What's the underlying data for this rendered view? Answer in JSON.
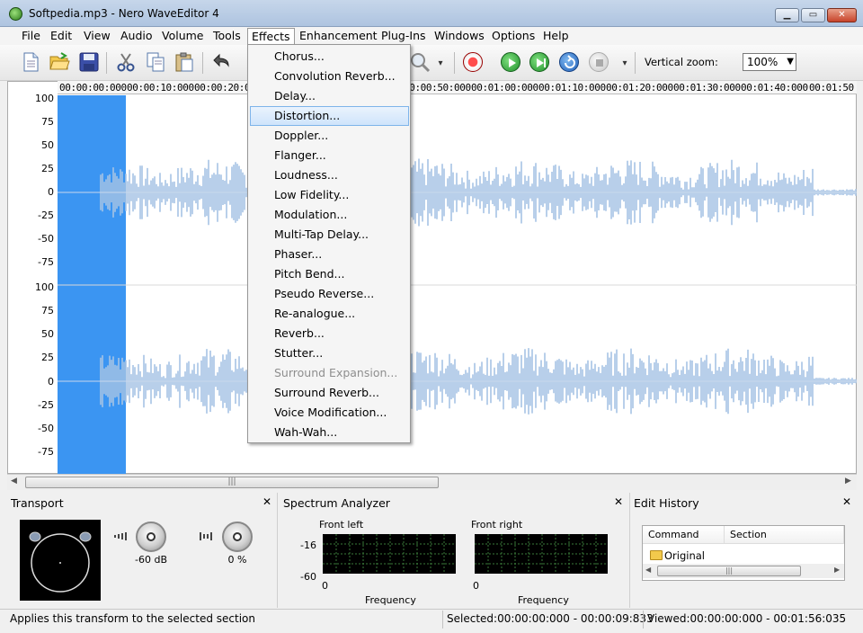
{
  "window": {
    "title": "Softpedia.mp3 - Nero WaveEditor 4"
  },
  "menu": [
    "File",
    "Edit",
    "View",
    "Audio",
    "Volume",
    "Tools",
    "Effects",
    "Enhancement",
    "Plug-Ins",
    "Windows",
    "Options",
    "Help"
  ],
  "toolbar": {
    "zoom_label": "Vertical zoom:",
    "zoom_value": "100%"
  },
  "ruler": [
    "00:00:00:000",
    "00:00:10:000",
    "00:00:20:000",
    "00:00:50:000",
    "00:01:00:000",
    "00:01:10:000",
    "00:01:20:000",
    "00:01:30:000",
    "00:01:40:000",
    "00:01:50"
  ],
  "y_axis_top": [
    "100",
    "75",
    "50",
    "25",
    "0",
    "-25",
    "-50",
    "-75"
  ],
  "y_axis_bottom": [
    "100",
    "75",
    "50",
    "25",
    "0",
    "-25",
    "-50",
    "-75"
  ],
  "effects_menu": [
    {
      "label": "Chorus...",
      "state": "normal"
    },
    {
      "label": "Convolution Reverb...",
      "state": "normal"
    },
    {
      "label": "Delay...",
      "state": "normal"
    },
    {
      "label": "Distortion...",
      "state": "hover"
    },
    {
      "label": "Doppler...",
      "state": "normal"
    },
    {
      "label": "Flanger...",
      "state": "normal"
    },
    {
      "label": "Loudness...",
      "state": "normal"
    },
    {
      "label": "Low Fidelity...",
      "state": "normal"
    },
    {
      "label": "Modulation...",
      "state": "normal"
    },
    {
      "label": "Multi-Tap Delay...",
      "state": "normal"
    },
    {
      "label": "Phaser...",
      "state": "normal"
    },
    {
      "label": "Pitch Bend...",
      "state": "normal"
    },
    {
      "label": "Pseudo Reverse...",
      "state": "normal"
    },
    {
      "label": "Re-analogue...",
      "state": "normal"
    },
    {
      "label": "Reverb...",
      "state": "normal"
    },
    {
      "label": "Stutter...",
      "state": "normal"
    },
    {
      "label": "Surround Expansion...",
      "state": "disabled"
    },
    {
      "label": "Surround Reverb...",
      "state": "normal"
    },
    {
      "label": "Voice Modification...",
      "state": "normal"
    },
    {
      "label": "Wah-Wah...",
      "state": "normal"
    }
  ],
  "transport": {
    "title": "Transport",
    "volume": "-60 dB",
    "balance": "0 %"
  },
  "spectrum": {
    "title": "Spectrum Analyzer",
    "left_label": "Front left",
    "right_label": "Front right",
    "ticks": [
      "-16",
      "-60"
    ],
    "zero": "0",
    "xlabel": "Frequency"
  },
  "history": {
    "title": "Edit History",
    "col_command": "Command",
    "col_section": "Section",
    "rows": [
      "Original"
    ]
  },
  "status": {
    "message": "Applies this transform to the selected section",
    "selected": "Selected:00:00:00:000 - 00:00:09:833",
    "viewed": "Viewed:00:00:00:000 - 00:01:56:035"
  },
  "colors": {
    "selection": "#3b95f2",
    "waveform": "#a6c3e4",
    "hover": "#cfe4fb"
  }
}
